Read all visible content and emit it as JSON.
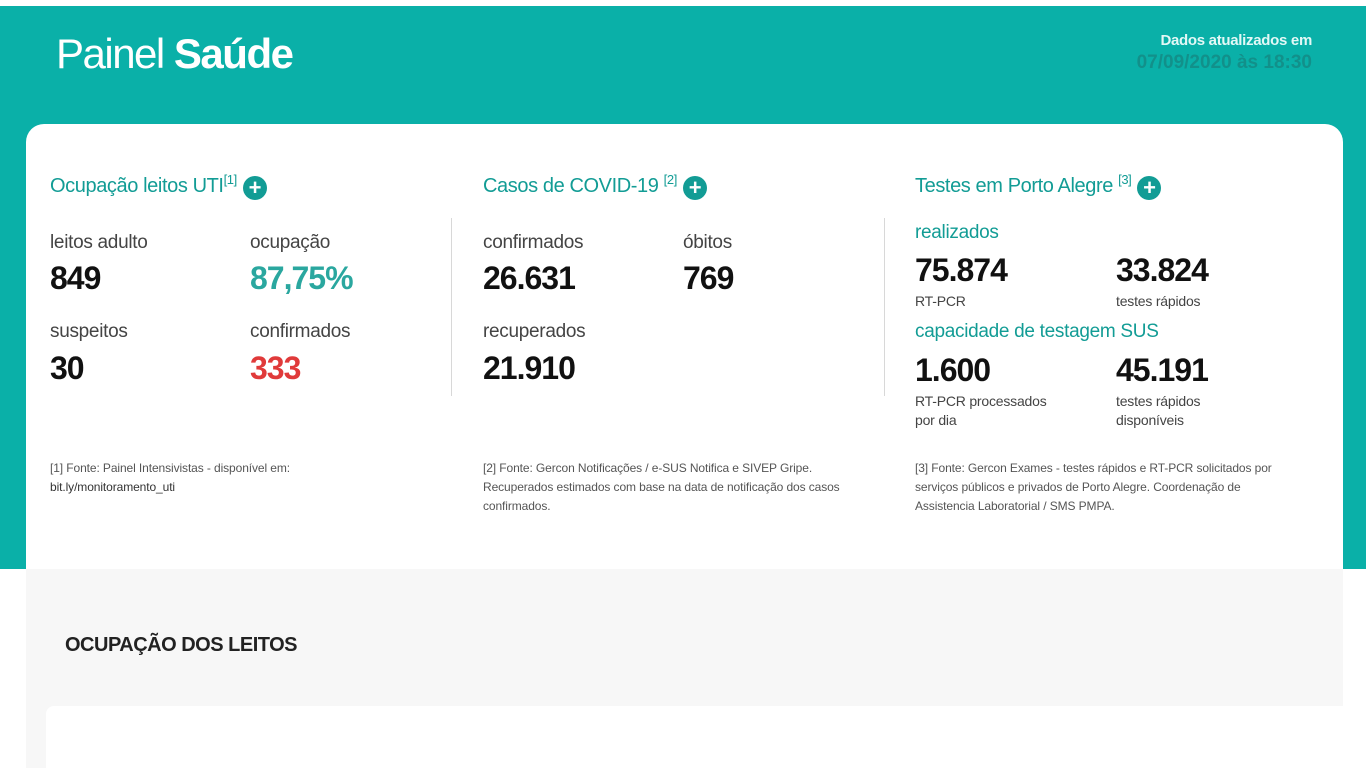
{
  "header": {
    "brand_light": "Painel ",
    "brand_bold": "Saúde",
    "updated_label": "Dados atualizados em",
    "updated_value": "07/09/2020 às 18:30"
  },
  "uti": {
    "title": "Ocupação leitos UTI",
    "ref": "[1]",
    "leitos_label": "leitos adulto",
    "leitos_value": "849",
    "ocupacao_label": "ocupação",
    "ocupacao_value": "87,75%",
    "suspeitos_label": "suspeitos",
    "suspeitos_value": "30",
    "confirmados_label": "confirmados",
    "confirmados_value": "333",
    "note_line1": "[1] Fonte: Painel Intensivistas - disponível em:",
    "note_line2": "bit.ly/monitoramento_uti"
  },
  "covid": {
    "title": "Casos de COVID-19",
    "ref": "[2]",
    "confirmados_label": "confirmados",
    "confirmados_value": "26.631",
    "obitos_label": "óbitos",
    "obitos_value": "769",
    "recuperados_label": "recuperados",
    "recuperados_value": "21.910",
    "note_line1": "[2] Fonte: Gercon Notificações / e-SUS Notifica e SIVEP Gripe.",
    "note_line2": "Recuperados estimados com base na data de notificação dos casos",
    "note_line3": "confirmados."
  },
  "testes": {
    "title": "Testes em Porto Alegre",
    "ref": "[3]",
    "realizados_label": "realizados",
    "rtpcr_value": "75.874",
    "rtpcr_label": "RT-PCR",
    "rapidos_value": "33.824",
    "rapidos_label": "testes rápidos",
    "capacidade_label": "capacidade de testagem SUS",
    "processados_value": "1.600",
    "processados_label_1": "RT-PCR processados",
    "processados_label_2": "por dia",
    "disponiveis_value": "45.191",
    "disponiveis_label_1": "testes rápidos",
    "disponiveis_label_2": "disponíveis",
    "note_line1": "[3] Fonte: Gercon Exames - testes rápidos e RT-PCR solicitados por",
    "note_line2": "serviços públicos e privados de Porto Alegre. Coordenação de",
    "note_line3": "Assistencia Laboratorial / SMS PMPA."
  },
  "section": {
    "title": "OCUPAÇÃO DOS LEITOS"
  },
  "colors": {
    "header_bg": "#0ab0a8",
    "teal_text": "#129c95",
    "alert_red": "#e03a3a"
  },
  "icons": {
    "expand": "plus-circle-icon"
  }
}
